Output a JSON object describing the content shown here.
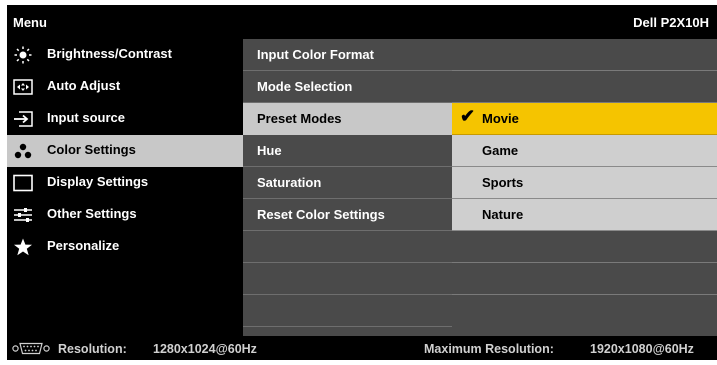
{
  "header": {
    "menu_title": "Menu",
    "model": "Dell P2X10H"
  },
  "left_menu": [
    {
      "label": "Brightness/Contrast",
      "icon": "brightness-icon"
    },
    {
      "label": "Auto Adjust",
      "icon": "auto-adjust-icon"
    },
    {
      "label": "Input source",
      "icon": "input-source-icon"
    },
    {
      "label": "Color Settings",
      "icon": "color-settings-icon",
      "selected": true
    },
    {
      "label": "Display Settings",
      "icon": "display-settings-icon"
    },
    {
      "label": "Other Settings",
      "icon": "other-settings-icon"
    },
    {
      "label": "Personalize",
      "icon": "star-icon"
    }
  ],
  "color_menu": [
    {
      "label": "Input Color Format"
    },
    {
      "label": "Mode Selection"
    },
    {
      "label": "Preset Modes",
      "selected": true
    },
    {
      "label": "Hue"
    },
    {
      "label": "Saturation"
    },
    {
      "label": "Reset Color Settings"
    }
  ],
  "preset_options": [
    {
      "label": "Movie",
      "selected": true
    },
    {
      "label": "Game"
    },
    {
      "label": "Sports"
    },
    {
      "label": "Nature"
    }
  ],
  "status": {
    "resolution_label": "Resolution:",
    "resolution_value": "1280x1024@60Hz",
    "max_resolution_label": "Maximum Resolution:",
    "max_resolution_value": "1920x1080@60Hz"
  },
  "colors": {
    "highlight": "#f5c400",
    "selected_row": "#c8c8c8",
    "panel": "#4a4a4a"
  }
}
